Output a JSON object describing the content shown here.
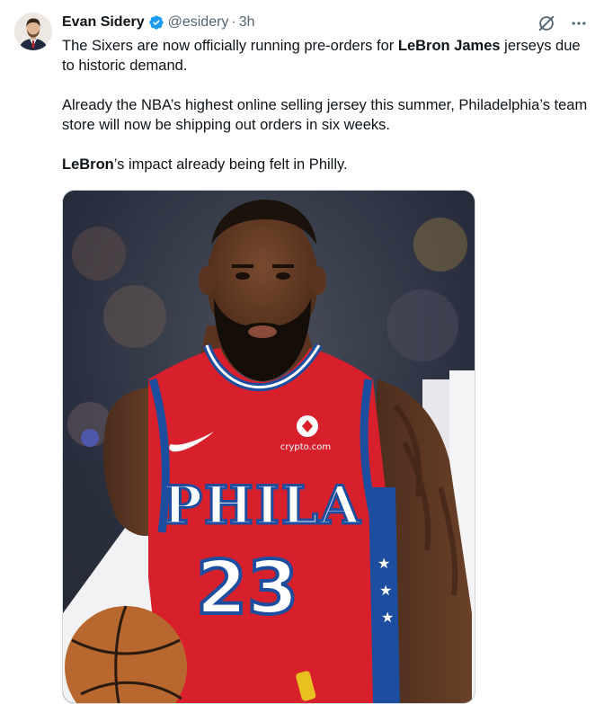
{
  "author": {
    "name": "Evan Sidery",
    "handle": "@esidery",
    "time": "3h",
    "separator": "·"
  },
  "tweet": {
    "p1_before": "The Sixers are now officially running pre-orders for ",
    "p1_bold": "LeBron James",
    "p1_after": " jerseys due to historic demand.",
    "p2": "Already the NBA’s highest online selling jersey this summer, Philadelphia’s team store will now be shipping out orders in six weeks.",
    "p3_bold": "LeBron",
    "p3_after": "’s impact already being felt in Philly."
  },
  "image": {
    "jersey_text": "PHILA",
    "jersey_number": "23",
    "sponsor": "crypto.com"
  },
  "colors": {
    "jersey_red": "#d7202c",
    "jersey_blue": "#1d4d9e",
    "verified_blue": "#1d9bf0"
  },
  "icons": {
    "grok": "grok-icon",
    "more": "more-icon",
    "verified": "verified-badge-icon"
  }
}
